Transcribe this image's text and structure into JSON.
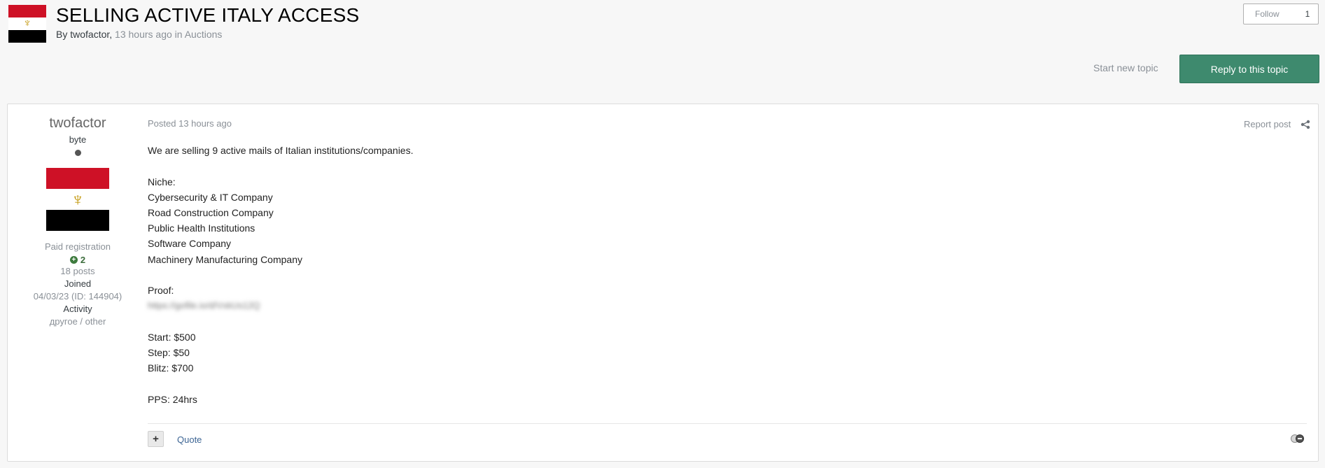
{
  "topic": {
    "title": "SELLING ACTIVE ITALY ACCESS",
    "byline_prefix": "By ",
    "author": "twofactor",
    "comma": ",",
    "time": "13 hours ago",
    "in_word": "in",
    "forum": "Auctions",
    "flag_icon": "egypt-flag-icon"
  },
  "follow": {
    "label": "Follow",
    "count": "1"
  },
  "actions": {
    "start_new_topic": "Start new topic",
    "reply": "Reply to this topic"
  },
  "post": {
    "author": {
      "name": "twofactor",
      "rank": "byte",
      "status_icon": "offline-dot-icon",
      "group": "Paid registration",
      "reputation": "2",
      "posts": "18 posts",
      "joined_label": "Joined",
      "joined_value": "04/03/23 (ID: 144904)",
      "activity_label": "Activity",
      "activity_value": "другое / other"
    },
    "meta": "Posted 13 hours ago",
    "report": "Report post",
    "content": {
      "intro": "We are selling 9 active mails of Italian institutions/companies.",
      "niche_label": "Niche:",
      "niches": [
        "Cybersecurity & IT Company",
        "Road Construction Company",
        "Public Health Institutions",
        "Software Company",
        "Machinery Manufacturing Company"
      ],
      "proof_label": "Proof:",
      "proof_link": "https://gofile.io/d/VxkUs12Q",
      "start": "Start: $500",
      "step": "Step: $50",
      "blitz": "Blitz: $700",
      "pps": "PPS: 24hrs"
    },
    "footer": {
      "quote": "Quote"
    }
  },
  "colors": {
    "reply_button": "#3e8a6e",
    "link": "#3d6594",
    "flag_red": "#ce1126",
    "flag_black": "#000000",
    "eagle_gold": "#c09300"
  }
}
